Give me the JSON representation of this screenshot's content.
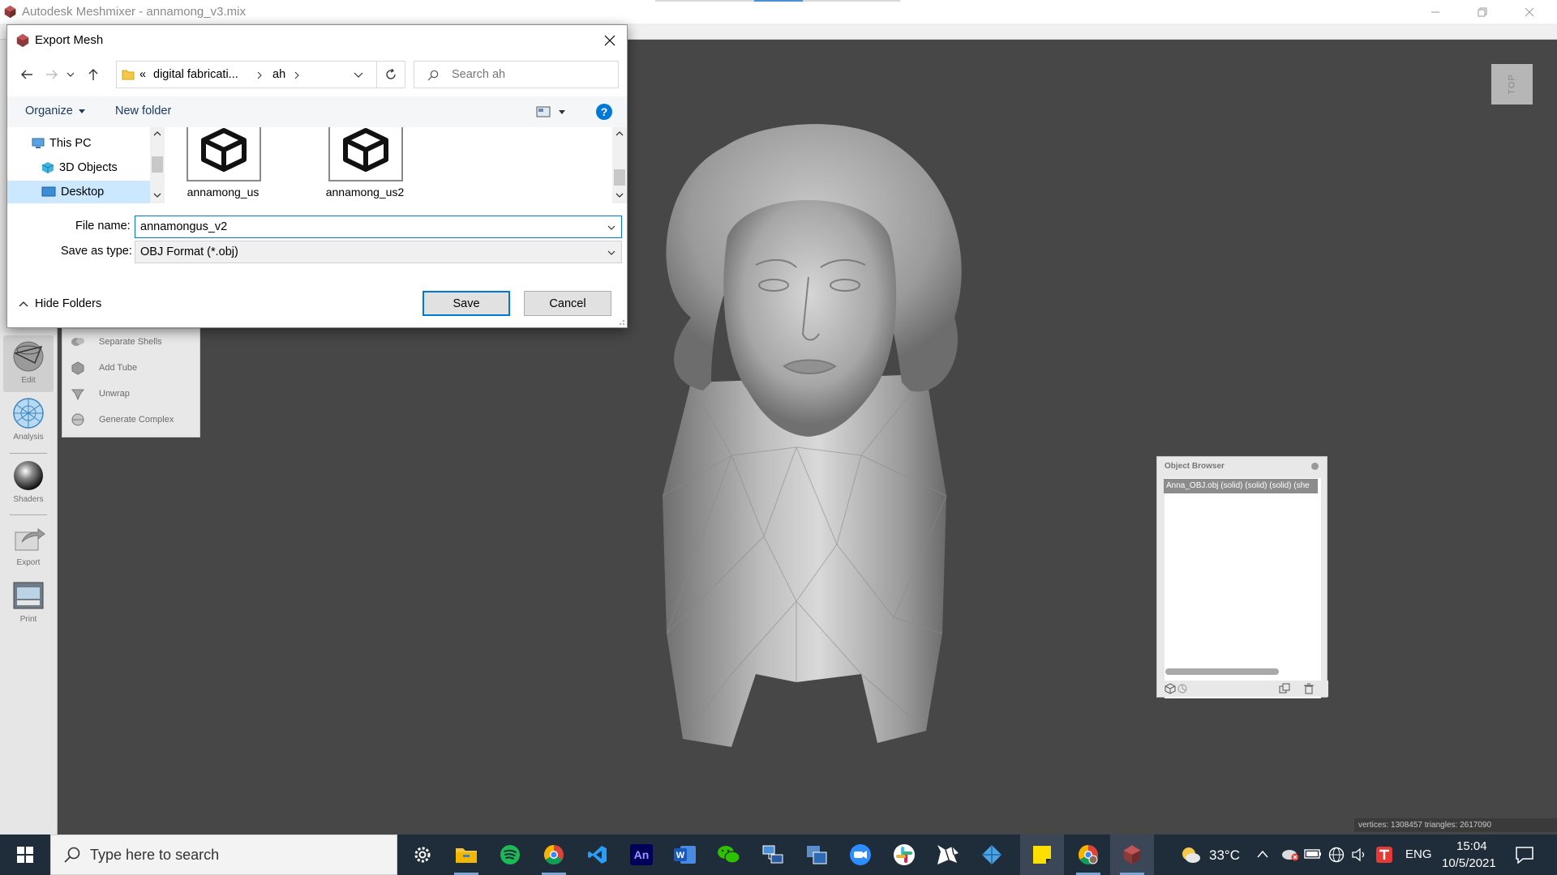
{
  "window": {
    "title": "Autodesk Meshmixer - annamong_v3.mix"
  },
  "left_toolbar": {
    "tools": [
      {
        "label": "Edit",
        "icon": "edit-sphere-icon"
      },
      {
        "label": "Analysis",
        "icon": "analysis-sphere-icon"
      },
      {
        "label": "Shaders",
        "icon": "shaders-sphere-icon"
      },
      {
        "label": "Export",
        "icon": "export-icon"
      },
      {
        "label": "Print",
        "icon": "print-icon"
      }
    ]
  },
  "edit_submenu": {
    "items": [
      {
        "label": "Separate Shells"
      },
      {
        "label": "Add Tube"
      },
      {
        "label": "Unwrap"
      },
      {
        "label": "Generate Complex"
      }
    ]
  },
  "view_cube": {
    "label": "TOP"
  },
  "object_browser": {
    "title": "Object Browser",
    "items": [
      {
        "label": "Anna_OBJ.obj (solid) (solid) (solid) (she",
        "selected": true
      }
    ]
  },
  "stats": {
    "text": "vertices: 1308457 triangles: 2617090"
  },
  "dialog": {
    "title": "Export Mesh",
    "breadcrumb": {
      "overflow": "«",
      "items": [
        "digital fabricati...",
        "ah"
      ]
    },
    "search": {
      "placeholder": "Search ah"
    },
    "toolbar": {
      "organize": "Organize",
      "new_folder": "New folder"
    },
    "nav": {
      "items": [
        {
          "label": "This PC",
          "icon": "pc-icon"
        },
        {
          "label": "3D Objects",
          "icon": "3d-objects-icon"
        },
        {
          "label": "Desktop",
          "icon": "desktop-icon",
          "selected": true
        }
      ]
    },
    "files": [
      {
        "name": "annamong_us",
        "icon": "3d-file-icon"
      },
      {
        "name": "annamong_us2",
        "icon": "3d-file-icon"
      }
    ],
    "file_name": {
      "label": "File name:",
      "value": "annamongus_v2"
    },
    "save_type": {
      "label": "Save as type:",
      "value": "OBJ Format (*.obj)"
    },
    "hide_folders": "Hide Folders",
    "save": "Save",
    "cancel": "Cancel"
  },
  "taskbar": {
    "search_placeholder": "Type here to search",
    "apps": [
      {
        "name": "settings-icon"
      },
      {
        "name": "file-explorer-icon"
      },
      {
        "name": "spotify-icon"
      },
      {
        "name": "chrome-icon"
      },
      {
        "name": "vscode-icon"
      },
      {
        "name": "animate-icon",
        "label": "An"
      },
      {
        "name": "word-icon",
        "label": "W"
      },
      {
        "name": "wechat-icon"
      },
      {
        "name": "network-app-icon"
      },
      {
        "name": "screen-app-icon"
      },
      {
        "name": "zoom-icon"
      },
      {
        "name": "slack-icon"
      },
      {
        "name": "rhino-icon"
      },
      {
        "name": "app-diamond-icon"
      },
      {
        "name": "sticky-notes-icon"
      },
      {
        "name": "chrome-profile-icon"
      },
      {
        "name": "meshmixer-icon"
      }
    ],
    "weather": "33°C",
    "language": "ENG",
    "time": "15:04",
    "date": "10/5/2021"
  },
  "colors": {
    "viewport_bg": "#474747",
    "accent": "#0078d7",
    "taskbar_bg": "#1f2c3a"
  }
}
